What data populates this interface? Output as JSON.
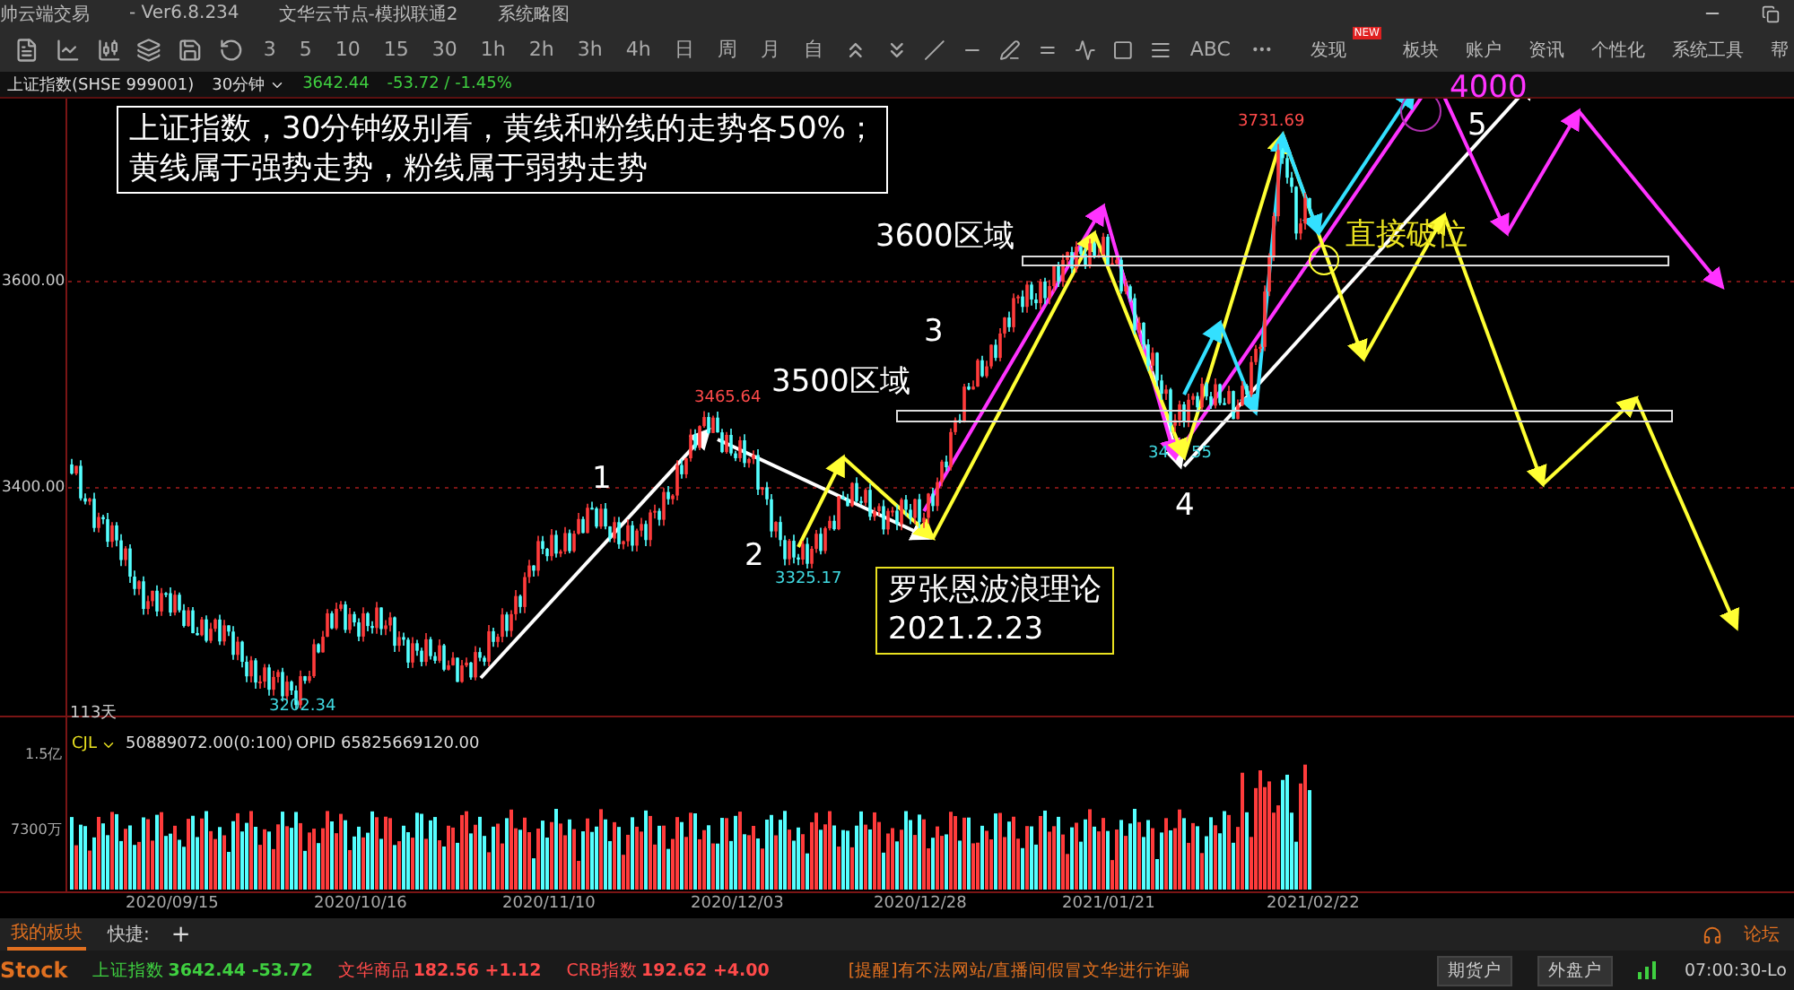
{
  "title_bar": {
    "app": "帅云端交易",
    "version": "- Ver6.8.234",
    "node": "文华云节点-模拟联通2",
    "sketch": "系统略图"
  },
  "toolbar": {
    "periods": [
      "3",
      "5",
      "10",
      "15",
      "30",
      "1h",
      "2h",
      "3h",
      "4h",
      "日",
      "周",
      "月",
      "自"
    ],
    "text_tool": "ABC",
    "menu": [
      {
        "label": "发现",
        "badge": "NEW"
      },
      {
        "label": "板块"
      },
      {
        "label": "账户"
      },
      {
        "label": "资讯"
      },
      {
        "label": "个性化"
      },
      {
        "label": "系统工具"
      },
      {
        "label": "帮"
      }
    ]
  },
  "header": {
    "symbol": "上证指数(SHSE 999001)",
    "period": "30分钟",
    "price": "3642.44",
    "change": "-53.72 / -1.45%"
  },
  "price_axis": [
    "3600.00",
    "3400.00"
  ],
  "bar_count": "113天",
  "note_box": {
    "lines": [
      "上证指数，30分钟级别看，黄线和粉线的走势各50%；",
      "黄线属于强势走势，粉线属于弱势走势"
    ]
  },
  "zone_labels": [
    "3600区域",
    "3500区域"
  ],
  "wave_numbers": [
    "1",
    "2",
    "3",
    "4",
    "5"
  ],
  "price_marks": [
    {
      "text": "3465.64",
      "kind": "high"
    },
    {
      "text": "3325.17",
      "kind": "low"
    },
    {
      "text": "3202.34",
      "kind": "low"
    },
    {
      "text": "3731.69",
      "kind": "high"
    },
    {
      "text": "34",
      "kind": "low"
    },
    {
      "text": "55",
      "kind": "low"
    }
  ],
  "theory_box": {
    "lines": [
      "罗张恩波浪理论",
      "2021.2.23"
    ]
  },
  "break_label": "直接破位",
  "target_label": "4000",
  "volume": {
    "indicator": "CJL",
    "value": "50889072.00(0:100)",
    "opid": "OPID 65825669120.00",
    "axis": [
      "1.5亿",
      "7300万"
    ]
  },
  "dates": [
    "2020/09/15",
    "2020/10/16",
    "2020/11/10",
    "2020/12/03",
    "2020/12/28",
    "2021/01/21",
    "2021/02/22"
  ],
  "tabs": [
    {
      "label": "我的板块",
      "selected": true
    }
  ],
  "quick_label": "快捷:",
  "add_label": "+",
  "forum": "论坛",
  "status": {
    "logo": "Stock",
    "tickers": [
      {
        "name": "上证指数",
        "price": "3642.44",
        "change": "-53.72",
        "color": "#3fd040"
      },
      {
        "name": "文华商品",
        "price": "182.56",
        "change": "+1.12",
        "color": "#ff4a4a"
      },
      {
        "name": "CRB指数",
        "price": "192.62",
        "change": "+4.00",
        "color": "#ff4a4a"
      }
    ],
    "notice": "[提醒]有不法网站/直播间假冒文华进行诈骗",
    "accounts": [
      "期货户",
      "外盘户"
    ],
    "clock": "07:00:30-Lo"
  }
}
